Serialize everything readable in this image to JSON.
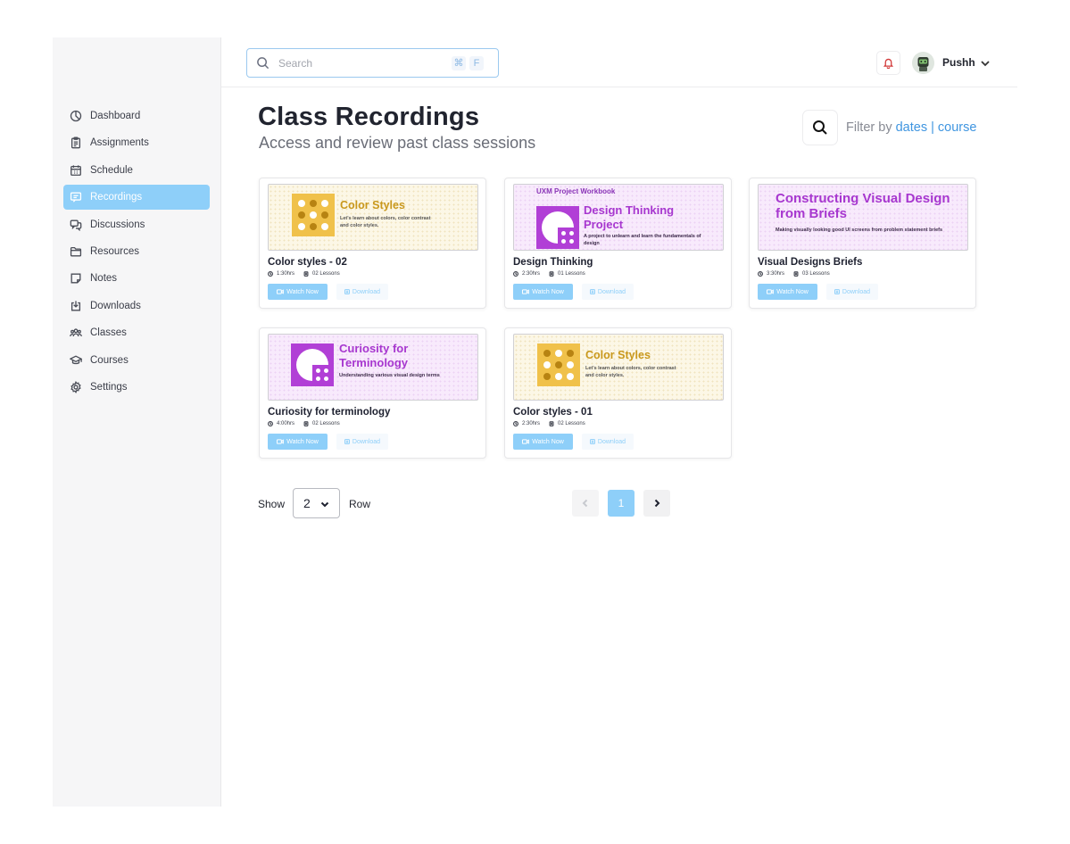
{
  "sidebar": {
    "items": [
      {
        "label": "Dashboard",
        "icon": "dashboard-icon"
      },
      {
        "label": "Assignments",
        "icon": "clipboard-icon"
      },
      {
        "label": "Schedule",
        "icon": "calendar-icon"
      },
      {
        "label": "Recordings",
        "icon": "video-chat-icon",
        "active": true
      },
      {
        "label": "Discussions",
        "icon": "chat-bubbles-icon"
      },
      {
        "label": "Resources",
        "icon": "folder-icon"
      },
      {
        "label": "Notes",
        "icon": "note-icon"
      },
      {
        "label": "Downloads",
        "icon": "download-icon"
      },
      {
        "label": "Classes",
        "icon": "users-icon"
      },
      {
        "label": "Courses",
        "icon": "graduation-cap-icon"
      },
      {
        "label": "Settings",
        "icon": "gear-icon"
      }
    ]
  },
  "topbar": {
    "search_placeholder": "Search",
    "shortcut_keys": [
      "⌘",
      "F"
    ],
    "user_name": "Pushh"
  },
  "header": {
    "title": "Class Recordings",
    "subtitle": "Access and review past class sessions",
    "filter_prefix": "Filter by",
    "filter_dates": "dates",
    "filter_separator": "|",
    "filter_course": "course"
  },
  "cards": [
    {
      "title": "Color styles - 02",
      "duration": "1:30hrs",
      "lessons": "02 Lessons",
      "watch_label": "Watch Now",
      "download_label": "Download",
      "thumb": {
        "theme": "yellow",
        "heading": "Color Styles",
        "text": "Let's learn about colors, color contrast and  color styles."
      }
    },
    {
      "title": "Design Thinking",
      "duration": "2:30hrs",
      "lessons": "01 Lessons",
      "watch_label": "Watch Now",
      "download_label": "Download",
      "thumb": {
        "theme": "purple",
        "brand": "UXM Project Workbook",
        "heading": "Design Thinking Project",
        "text": "A project to unlearn and learn the fundamentals of design"
      }
    },
    {
      "title": "Visual Designs Briefs",
      "duration": "3:30hrs",
      "lessons": "03 Lessons",
      "watch_label": "Watch Now",
      "download_label": "Download",
      "thumb": {
        "theme": "purple",
        "heading": "Constructing Visual Design from Briefs",
        "text": "Making visually looking good UI screens from problem statement briefs"
      }
    },
    {
      "title": "Curiosity for terminology",
      "duration": "4:00hrs",
      "lessons": "02 Lessons",
      "watch_label": "Watch Now",
      "download_label": "Download",
      "thumb": {
        "theme": "purple",
        "heading": "Curiosity for Terminology",
        "text": "Understanding various visual design terms"
      }
    },
    {
      "title": "Color styles - 01",
      "duration": "2:30hrs",
      "lessons": "02 Lessons",
      "watch_label": "Watch Now",
      "download_label": "Download",
      "thumb": {
        "theme": "yellow",
        "heading": "Color Styles",
        "text": "Let's learn about colors, color contrast and  color styles."
      }
    }
  ],
  "pagination": {
    "show_label": "Show",
    "rows_value": "2",
    "row_label": "Row",
    "current_page": "1"
  },
  "colors": {
    "accent": "#8ecff9",
    "link": "#3f95e0",
    "yellow_brand": "#f0c14a",
    "purple_brand": "#b13fd6"
  }
}
